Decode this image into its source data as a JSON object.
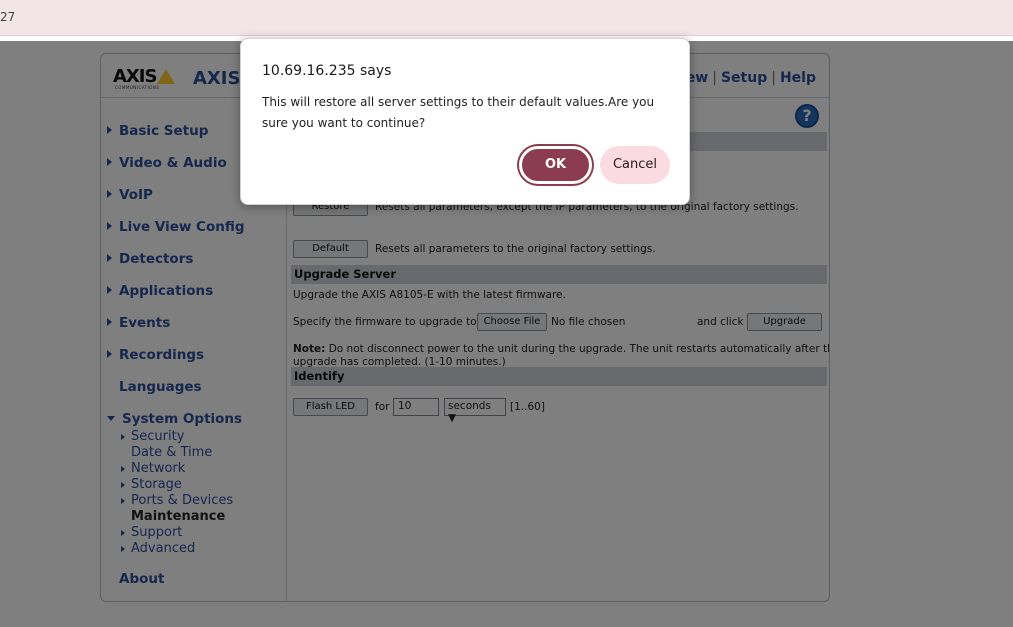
{
  "browser": {
    "title_fragment": "27"
  },
  "header": {
    "logo_text": "AXIS",
    "logo_sub": "COMMUNICATIONS",
    "brand": "AXIS",
    "nav": [
      "ew",
      "Setup",
      "Help"
    ],
    "separator": "|"
  },
  "sidebar": {
    "items": [
      {
        "label": "Basic Setup"
      },
      {
        "label": "Video & Audio"
      },
      {
        "label": "VoIP"
      },
      {
        "label": "Live View Config"
      },
      {
        "label": "Detectors"
      },
      {
        "label": "Applications"
      },
      {
        "label": "Events"
      },
      {
        "label": "Recordings"
      },
      {
        "label": "Languages"
      },
      {
        "label": "System Options"
      },
      {
        "label": "About"
      }
    ],
    "system_options_sub": [
      {
        "label": "Security"
      },
      {
        "label": "Date & Time"
      },
      {
        "label": "Network"
      },
      {
        "label": "Storage"
      },
      {
        "label": "Ports & Devices"
      },
      {
        "label": "Maintenance"
      },
      {
        "label": "Support"
      },
      {
        "label": "Advanced"
      }
    ]
  },
  "content": {
    "help_icon": "?",
    "restore_button": "Restore",
    "restore_desc": "Resets all parameters, except the IP parameters, to the original factory settings.",
    "default_button": "Default",
    "default_desc": "Resets all parameters to the original factory settings.",
    "upgrade_section": "Upgrade Server",
    "upgrade_desc": "Upgrade the AXIS A8105-E with the latest firmware.",
    "specify_label": "Specify the firmware to upgrade to:",
    "choose_file_button": "Choose File",
    "no_file": "No file chosen",
    "and_click": "and click",
    "upgrade_button": "Upgrade",
    "note_label": "Note:",
    "note_text": "Do not disconnect power to the unit during the upgrade. The unit restarts automatically after the",
    "note_text2": "upgrade has completed. (1-10 minutes.)",
    "identify_section": "Identify",
    "flash_led_button": "Flash LED",
    "for_label": "for",
    "duration_value": "10",
    "duration_unit": "seconds",
    "range": "[1..60]"
  },
  "dialog": {
    "title": "10.69.16.235 says",
    "message": "This will restore all server settings to their default values.Are you sure you want to continue?",
    "ok_label": "OK",
    "cancel_label": "Cancel"
  },
  "colors": {
    "accent": "#2b4f9b",
    "ok_button": "#8b3c50",
    "cancel_button": "#fadbe2"
  }
}
